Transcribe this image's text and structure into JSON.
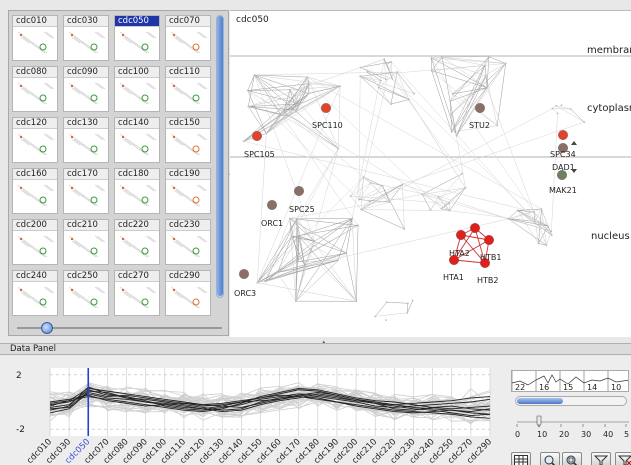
{
  "thumbnails": {
    "items": [
      {
        "label": "cdc010"
      },
      {
        "label": "cdc030"
      },
      {
        "label": "cdc050",
        "selected": true
      },
      {
        "label": "cdc070"
      },
      {
        "label": "cdc080"
      },
      {
        "label": "cdc090"
      },
      {
        "label": "cdc100"
      },
      {
        "label": "cdc110"
      },
      {
        "label": "cdc120"
      },
      {
        "label": "cdc130"
      },
      {
        "label": "cdc140"
      },
      {
        "label": "cdc150"
      },
      {
        "label": "cdc160"
      },
      {
        "label": "cdc170"
      },
      {
        "label": "cdc180"
      },
      {
        "label": "cdc190"
      },
      {
        "label": "cdc200"
      },
      {
        "label": "cdc210"
      },
      {
        "label": "cdc220"
      },
      {
        "label": "cdc230"
      },
      {
        "label": "cdc240"
      },
      {
        "label": "cdc250"
      },
      {
        "label": "cdc270"
      },
      {
        "label": "cdc290"
      }
    ]
  },
  "network": {
    "title": "cdc050",
    "regions": [
      "membrane",
      "cytoplasm",
      "nucleus"
    ],
    "nodes": [
      "SPC110",
      "SPC105",
      "STU2",
      "SPC34",
      "DAD1",
      "MAK21",
      "SPC25",
      "ORC1",
      "ORC3",
      "HTA2",
      "HTB1",
      "HTA1",
      "HTB2"
    ]
  },
  "data_panel": {
    "title": "Data Panel",
    "y_ticks": [
      "2",
      "-2"
    ],
    "selected_label": "cdc050"
  },
  "chart_data": {
    "type": "line",
    "x": [
      "cdc010",
      "cdc030",
      "cdc050",
      "cdc070",
      "cdc080",
      "cdc090",
      "cdc100",
      "cdc110",
      "cdc120",
      "cdc130",
      "cdc140",
      "cdc150",
      "cdc160",
      "cdc170",
      "cdc180",
      "cdc190",
      "cdc200",
      "cdc210",
      "cdc220",
      "cdc230",
      "cdc240",
      "cdc250",
      "cdc270",
      "cdc290"
    ],
    "ylim": [
      -2.5,
      2.5
    ],
    "y_ticks": [
      2,
      -2
    ],
    "grid": true,
    "highlight_x": "cdc050",
    "series": [
      {
        "values": [
          -0.4,
          -0.2,
          0.9,
          0.5,
          0.4,
          0.1,
          -0.3,
          -0.5,
          -0.6,
          -0.4,
          -0.2,
          0.2,
          0.4,
          0.6,
          0.5,
          0.3,
          0.1,
          -0.1,
          -0.3,
          -0.5,
          -0.6,
          -0.8,
          -1.0,
          -0.9
        ]
      },
      {
        "values": [
          -0.2,
          0.0,
          0.6,
          0.3,
          0.2,
          0.0,
          -0.1,
          -0.3,
          -0.5,
          -0.3,
          0.0,
          0.3,
          0.6,
          0.9,
          0.8,
          0.5,
          0.2,
          0.0,
          -0.2,
          -0.4,
          -0.5,
          -0.6,
          -0.7,
          -0.5
        ]
      },
      {
        "values": [
          -0.6,
          -0.3,
          1.1,
          0.6,
          0.3,
          0.2,
          0.0,
          -0.2,
          -0.4,
          -0.6,
          -0.5,
          0.0,
          0.3,
          0.5,
          0.4,
          0.2,
          0.0,
          -0.3,
          -0.4,
          -0.3,
          -0.2,
          -0.1,
          0.0,
          0.2
        ]
      },
      {
        "values": [
          -0.1,
          0.1,
          0.4,
          0.2,
          0.0,
          -0.2,
          -0.4,
          -0.6,
          -0.7,
          -0.5,
          -0.1,
          0.4,
          0.7,
          1.0,
          0.9,
          0.6,
          0.3,
          0.1,
          0.0,
          -0.2,
          -0.4,
          -0.5,
          -0.4,
          -0.3
        ]
      },
      {
        "values": [
          -0.8,
          -0.5,
          0.7,
          0.4,
          0.5,
          0.3,
          0.1,
          -0.1,
          -0.3,
          -0.2,
          0.0,
          0.1,
          0.2,
          0.4,
          0.3,
          0.0,
          -0.2,
          -0.4,
          -0.6,
          -0.7,
          -0.8,
          -0.9,
          -1.1,
          -1.2
        ]
      },
      {
        "values": [
          0.0,
          0.2,
          0.5,
          0.1,
          -0.1,
          -0.3,
          -0.2,
          -0.4,
          -0.5,
          -0.7,
          -0.6,
          -0.2,
          0.1,
          0.3,
          0.6,
          0.4,
          0.1,
          -0.1,
          -0.2,
          -0.1,
          0.0,
          0.1,
          0.3,
          0.4
        ]
      },
      {
        "values": [
          -0.5,
          -0.4,
          0.8,
          0.7,
          0.3,
          0.0,
          -0.2,
          -0.1,
          -0.2,
          -0.3,
          -0.4,
          -0.1,
          0.2,
          0.5,
          0.7,
          0.5,
          0.2,
          -0.1,
          -0.5,
          -0.6,
          -0.4,
          -0.3,
          -0.5,
          -0.6
        ]
      },
      {
        "values": [
          -0.3,
          0.1,
          1.0,
          0.8,
          0.6,
          0.4,
          0.2,
          0.0,
          -0.2,
          -0.1,
          0.1,
          0.3,
          0.5,
          0.4,
          0.2,
          0.0,
          -0.3,
          -0.5,
          -0.7,
          -0.8,
          -0.7,
          -0.6,
          -0.8,
          -0.9
        ]
      }
    ]
  },
  "controls": {
    "strip_numbers": [
      "22",
      "16",
      "15",
      "14",
      "10"
    ],
    "axis_ticks": [
      "0",
      "10",
      "20",
      "30",
      "40",
      "5"
    ],
    "buttons": [
      "heatmap-icon",
      "zoom-in-icon",
      "zoom-fit-icon",
      "filter-icon",
      "filter-clear-icon"
    ]
  }
}
